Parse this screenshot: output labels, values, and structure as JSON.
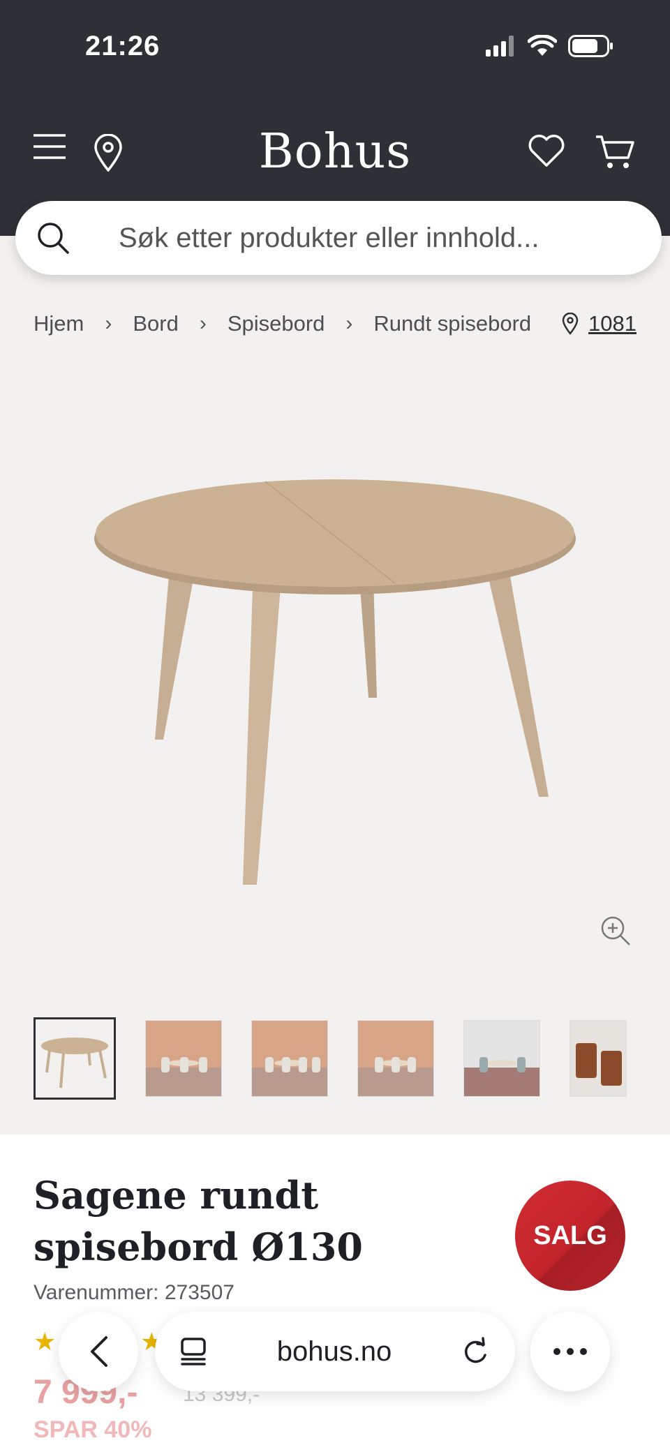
{
  "status_bar": {
    "time": "21:26"
  },
  "header": {
    "logo": "Bohus"
  },
  "search": {
    "placeholder": "Søk etter produkter eller innhold..."
  },
  "breadcrumb": [
    "Hjem",
    "Bord",
    "Spisebord",
    "Rundt spisebord"
  ],
  "store": {
    "number": "1081"
  },
  "product": {
    "title": "Sagene rundt spisebord Ø130",
    "sku": "Varenummer: 273507",
    "badge": "SALG",
    "price": "7 999,-",
    "old_price": "13 399,-",
    "discount": "SPAR 40%",
    "rating_stars": 5
  },
  "browser": {
    "url": "bohus.no"
  },
  "colors": {
    "header_bg": "#2f3035",
    "page_bg": "#f3f1ef",
    "sale_red": "#c3232b",
    "star": "#e7b400"
  },
  "icons": [
    "menu-icon",
    "location-pin-icon",
    "heart-icon",
    "cart-icon",
    "search-icon",
    "chevron-right-icon",
    "zoom-in-icon",
    "back-icon",
    "tabs-icon",
    "reload-icon",
    "more-icon"
  ]
}
